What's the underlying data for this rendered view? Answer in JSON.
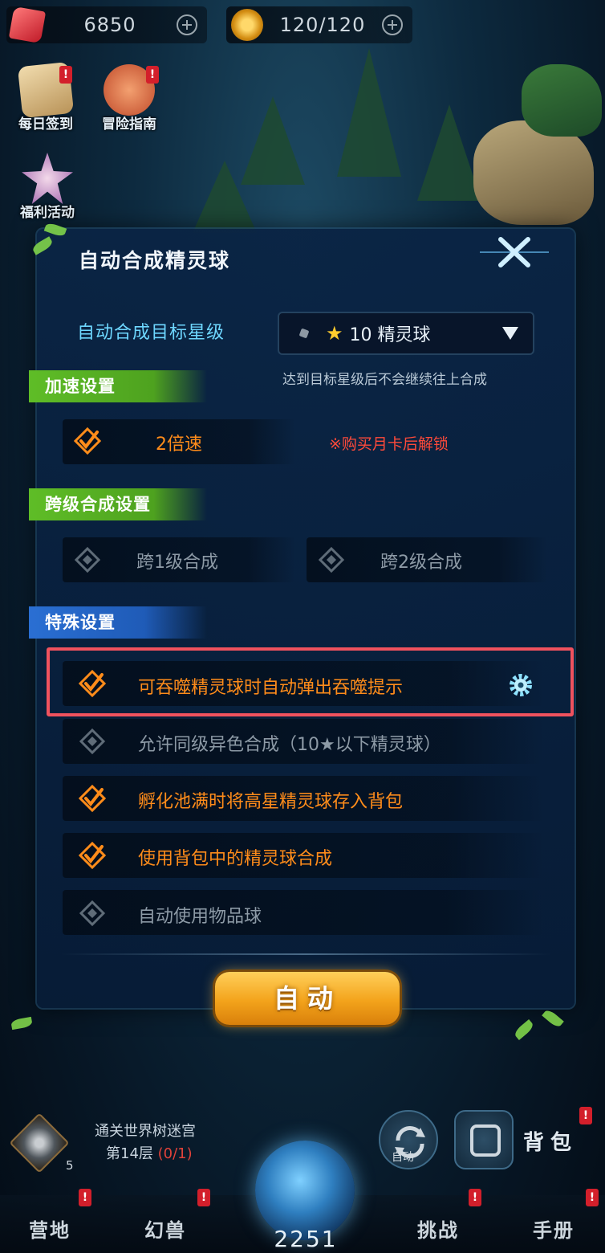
{
  "resources": {
    "gems": "6850",
    "stamina": "120/120"
  },
  "side_icons": [
    {
      "label": "每日签到"
    },
    {
      "label": "冒险指南"
    },
    {
      "label": "福利活动"
    }
  ],
  "dialog": {
    "title": "自动合成精灵球",
    "target_label": "自动合成目标星级",
    "target_value": "10 精灵球",
    "note": "达到目标星级后不会继续往上合成",
    "speed_section": "加速设置",
    "speed_option": "2倍速",
    "speed_lock_note": "※购买月卡后解锁",
    "cross_section": "跨级合成设置",
    "cross_options": [
      "跨1级合成",
      "跨2级合成"
    ],
    "special_section": "特殊设置",
    "special_options": [
      {
        "label": "可吞噬精灵球时自动弹出吞噬提示",
        "checked": true
      },
      {
        "label": "允许同级异色合成（10★以下精灵球）",
        "checked": false
      },
      {
        "label": "孵化池满时将高星精灵球存入背包",
        "checked": true
      },
      {
        "label": "使用背包中的精灵球合成",
        "checked": true
      },
      {
        "label": "自动使用物品球",
        "checked": false
      }
    ],
    "auto_button": "自动"
  },
  "bottom": {
    "stage_name": "通关世界树迷宫",
    "stage_floor": "第14层",
    "stage_progress": "(0/1)",
    "stage_level": "5",
    "auto_round_label": "自动",
    "bag_label": "背包",
    "orb_value": "2251"
  },
  "nav": [
    "营地",
    "幻兽",
    "挑战",
    "手册"
  ],
  "colors": {
    "accent_orange": "#ff8c1a",
    "highlight_red": "#f0525e",
    "section_green": "#5fbd27",
    "section_blue": "#2a6fd3",
    "label_cyan": "#6ed7ff"
  }
}
